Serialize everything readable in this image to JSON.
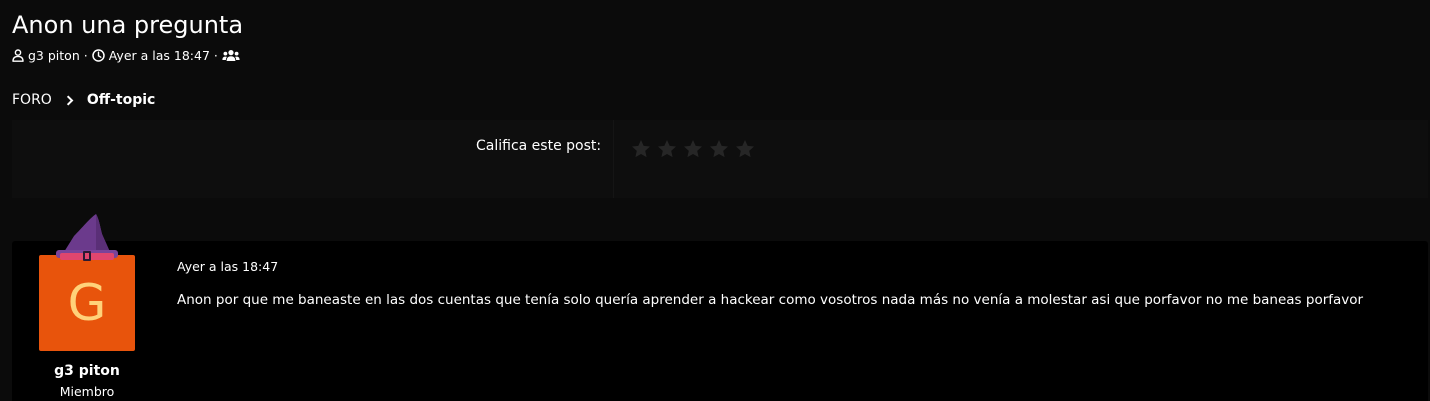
{
  "thread": {
    "title": "Anon una pregunta",
    "author": "g3 piton",
    "separator": "·",
    "posted": "Ayer a las 18:47"
  },
  "breadcrumb": {
    "root": "FORO",
    "current": "Off-topic"
  },
  "rating": {
    "label": "Califica este post:",
    "max_stars": 5,
    "current": 0
  },
  "post": {
    "date": "Ayer a las 18:47",
    "body": "Anon por que me baneaste en las dos cuentas que tenía solo quería aprender a hackear como vosotros nada más no venía a molestar asi que porfavor no me baneas porfavor",
    "author": {
      "avatar_letter": "G",
      "name": "g3 piton",
      "role": "Miembro"
    }
  },
  "icons": {
    "author": "user-icon",
    "time": "clock-icon",
    "audience": "users-icon",
    "breadcrumb_separator": "chevron-right-icon",
    "star": "star-icon",
    "avatar_decoration": "witch-hat-icon"
  },
  "colors": {
    "background": "#0b0b0b",
    "post_background": "#000000",
    "avatar_bg": "#e8540c",
    "avatar_letter": "#ffd27a",
    "star_empty": "#262626",
    "hat_purple": "#6b3a8c",
    "hat_band": "#e0466e"
  }
}
